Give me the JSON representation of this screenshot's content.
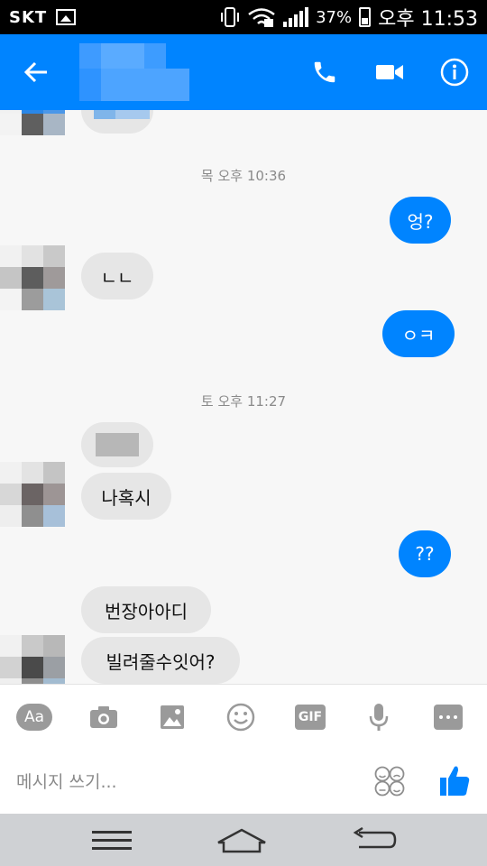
{
  "status_bar": {
    "carrier": "SKT",
    "battery_percent": "37%",
    "time": "오후 11:53"
  },
  "header": {
    "accent_color": "#0084ff",
    "back_icon": "arrow-left-icon",
    "call_icon": "phone-icon",
    "video_icon": "video-camera-icon",
    "info_icon": "info-icon"
  },
  "chat": {
    "timestamps": [
      "목 오후 10:36",
      "토 오후 11:27"
    ],
    "messages": [
      {
        "side": "out",
        "text": "엉?"
      },
      {
        "side": "in",
        "text": "ㄴㄴ"
      },
      {
        "side": "out",
        "text": "ㅇㅋ"
      },
      {
        "side": "in",
        "text": "나혹시"
      },
      {
        "side": "out",
        "text": "??"
      },
      {
        "side": "in",
        "text": "번장아아디"
      },
      {
        "side": "in",
        "text": "빌려줄수잇어?"
      }
    ]
  },
  "toolbar": {
    "aa_label": "Aa",
    "gif_label": "GIF",
    "icons": [
      "text-format-icon",
      "camera-icon",
      "image-icon",
      "smiley-icon",
      "gif-icon",
      "microphone-icon",
      "more-icon"
    ]
  },
  "composer": {
    "placeholder": "메시지 쓰기...",
    "sticker_icon": "sticker-faces-icon",
    "like_icon": "thumbs-up-icon"
  },
  "navbar": {
    "icons": [
      "menu-icon",
      "home-icon",
      "back-icon"
    ]
  }
}
